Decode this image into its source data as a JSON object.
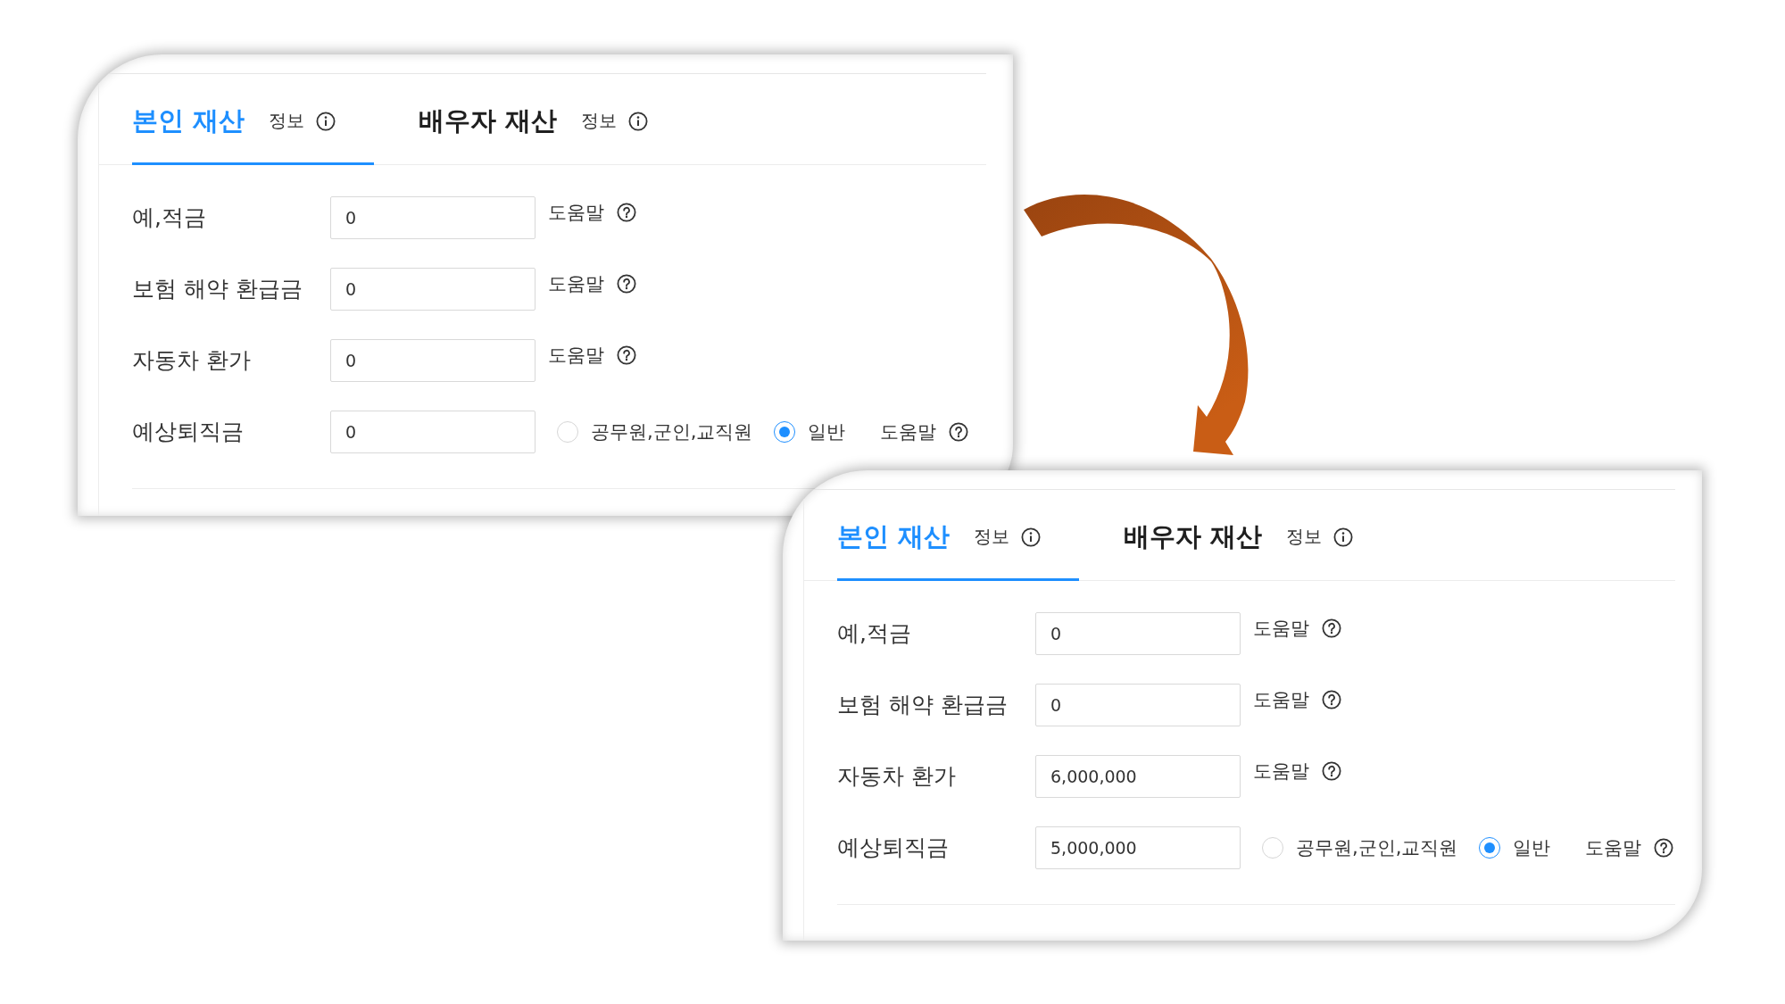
{
  "panels": [
    {
      "tabs": [
        {
          "label": "본인 재산",
          "info": "정보",
          "selected": true
        },
        {
          "label": "배우자 재산",
          "info": "정보",
          "selected": false
        }
      ],
      "fields": [
        {
          "label": "예,적금",
          "value": "0",
          "help": "도움말"
        },
        {
          "label": "보험 해약 환급금",
          "value": "0",
          "help": "도움말"
        },
        {
          "label": "자동차 환가",
          "value": "0",
          "help": "도움말"
        },
        {
          "label": "예상퇴직금",
          "value": "0",
          "options": [
            {
              "label": "공무원,군인,교직원",
              "selected": false
            },
            {
              "label": "일반",
              "selected": true
            }
          ],
          "help": "도움말"
        }
      ]
    },
    {
      "tabs": [
        {
          "label": "본인 재산",
          "info": "정보",
          "selected": true
        },
        {
          "label": "배우자 재산",
          "info": "정보",
          "selected": false
        }
      ],
      "fields": [
        {
          "label": "예,적금",
          "value": "0",
          "help": "도움말"
        },
        {
          "label": "보험 해약 환급금",
          "value": "0",
          "help": "도움말"
        },
        {
          "label": "자동차 환가",
          "value": "6,000,000",
          "help": "도움말"
        },
        {
          "label": "예상퇴직금",
          "value": "5,000,000",
          "options": [
            {
              "label": "공무원,군인,교직원",
              "selected": false
            },
            {
              "label": "일반",
              "selected": true
            }
          ],
          "help": "도움말"
        }
      ]
    }
  ]
}
